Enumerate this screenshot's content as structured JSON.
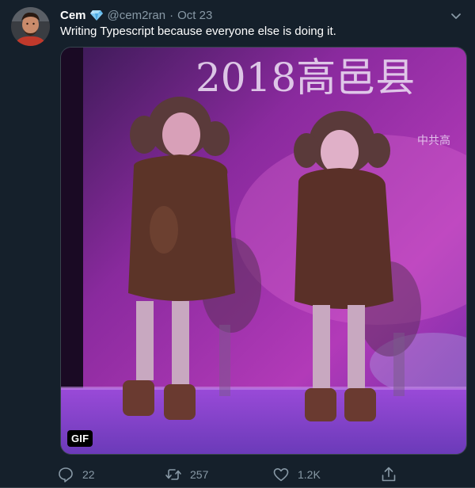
{
  "author": {
    "display_name": "Cem",
    "handle": "@cem2ran",
    "separator": "·",
    "timestamp": "Oct 23",
    "verified_icon": "diamond-emoji"
  },
  "tweet": {
    "text": "Writing Typescript because everyone else is doing it."
  },
  "media": {
    "badge": "GIF",
    "banner_text": "2018高邑县",
    "banner_subtext": "中共高"
  },
  "actions": {
    "reply": {
      "icon": "reply-icon",
      "count": "22"
    },
    "retweet": {
      "icon": "retweet-icon",
      "count": "257"
    },
    "like": {
      "icon": "heart-icon",
      "count": "1.2K"
    },
    "share": {
      "icon": "share-icon"
    }
  },
  "colors": {
    "background": "#15202b",
    "text_primary": "#ffffff",
    "text_secondary": "#8899a6",
    "border": "#38444d"
  }
}
